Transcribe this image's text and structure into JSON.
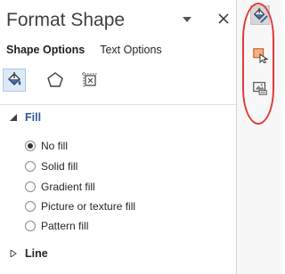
{
  "panel": {
    "title": "Format Shape",
    "tabs": [
      {
        "label": "Shape Options",
        "active": true
      },
      {
        "label": "Text Options",
        "active": false
      }
    ],
    "categories": [
      {
        "name": "fill-and-line",
        "icon": "paint-bucket-icon",
        "active": true
      },
      {
        "name": "effects",
        "icon": "pentagon-icon",
        "active": false
      },
      {
        "name": "size-and-properties",
        "icon": "size-properties-icon",
        "active": false
      }
    ],
    "fill": {
      "label": "Fill",
      "expanded": true,
      "options": [
        {
          "label": "No fill",
          "selected": true
        },
        {
          "label": "Solid fill",
          "selected": false
        },
        {
          "label": "Gradient fill",
          "selected": false
        },
        {
          "label": "Picture or texture fill",
          "selected": false
        },
        {
          "label": "Pattern fill",
          "selected": false
        }
      ]
    },
    "line": {
      "label": "Line",
      "expanded": false
    }
  },
  "side_strip": {
    "buttons": [
      {
        "icon": "paint-bucket-icon",
        "active": true
      },
      {
        "icon": "shape-cursor-icon",
        "active": false
      },
      {
        "icon": "picture-format-icon",
        "active": false
      }
    ]
  },
  "colors": {
    "accent": "#2b579a",
    "highlight": "#e23a3a",
    "active_tab_bg": "#dbe9f8"
  }
}
